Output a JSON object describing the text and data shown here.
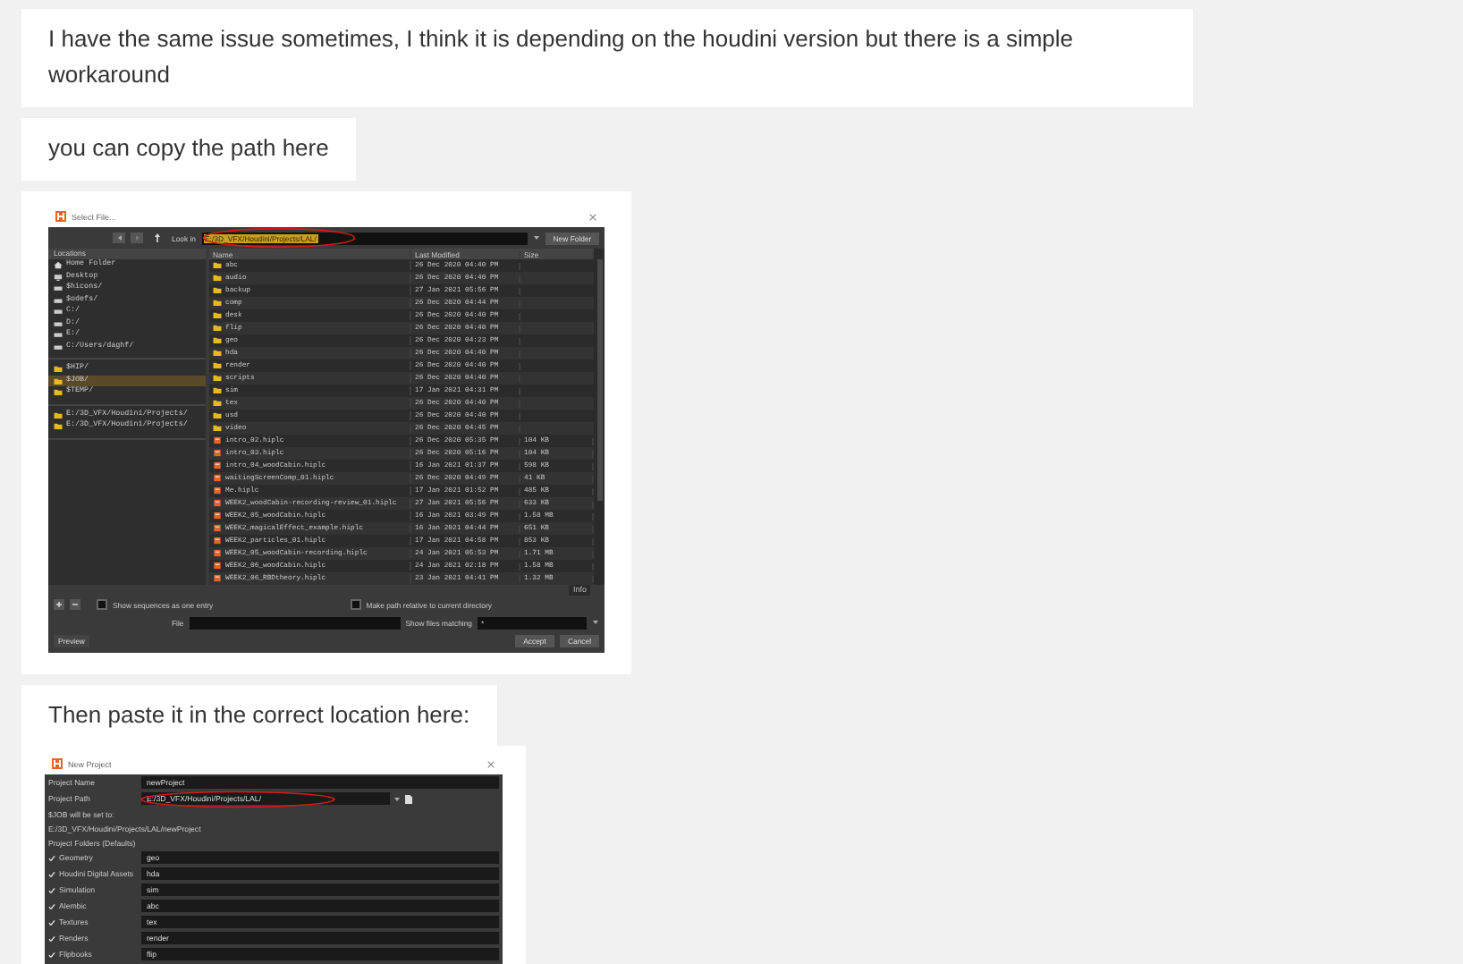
{
  "messages": [
    {
      "kind": "text",
      "text": "I have the same issue sometimes, I think it is depending on the houdini version but there is a simple workaround"
    },
    {
      "kind": "text",
      "text": "you can copy the path here"
    },
    {
      "kind": "file_dialog",
      "title": "Select File...",
      "look_in_label": "Look in",
      "path": "E:/3D_VFX/Houdini/Projects/LAL/",
      "new_folder": "New Folder",
      "locations_header": "Locations",
      "location_groups": [
        {
          "items": [
            {
              "label": "Home Folder",
              "selected": false
            },
            {
              "label": "Desktop",
              "selected": false
            },
            {
              "label": "$hicons/",
              "selected": false
            },
            {
              "label": "$odefs/",
              "selected": false
            },
            {
              "label": "C:/",
              "selected": false
            },
            {
              "label": "D:/",
              "selected": false
            },
            {
              "label": "E:/",
              "selected": false
            },
            {
              "label": "C:/Users/daghf/",
              "selected": false
            }
          ]
        },
        {
          "items": [
            {
              "label": "$HIP/",
              "selected": false
            },
            {
              "label": "$JOB/",
              "selected": true
            },
            {
              "label": "$TEMP/",
              "selected": false
            }
          ]
        },
        {
          "items": [
            {
              "label": "E:/3D_VFX/Houdini/Projects/",
              "selected": false
            },
            {
              "label": "E:/3D_VFX/Houdini/Projects/",
              "selected": false
            }
          ]
        }
      ],
      "columns": [
        "Name",
        "Last Modified",
        "Size"
      ],
      "files": [
        {
          "kind": "folder",
          "name": "abc",
          "modified": "26 Dec 2020 04:40 PM"
        },
        {
          "kind": "folder",
          "name": "audio",
          "modified": "26 Dec 2020 04:40 PM"
        },
        {
          "kind": "folder",
          "name": "backup",
          "modified": "27 Jan 2021 05:56 PM"
        },
        {
          "kind": "folder",
          "name": "comp",
          "modified": "26 Dec 2020 04:44 PM"
        },
        {
          "kind": "folder",
          "name": "desk",
          "modified": "26 Dec 2020 04:40 PM"
        },
        {
          "kind": "folder",
          "name": "flip",
          "modified": "26 Dec 2020 04:40 PM"
        },
        {
          "kind": "folder",
          "name": "geo",
          "modified": "26 Dec 2020 04:23 PM"
        },
        {
          "kind": "folder",
          "name": "hda",
          "modified": "26 Dec 2020 04:40 PM"
        },
        {
          "kind": "folder",
          "name": "render",
          "modified": "26 Dec 2020 04:40 PM"
        },
        {
          "kind": "folder",
          "name": "scripts",
          "modified": "26 Dec 2020 04:40 PM"
        },
        {
          "kind": "folder",
          "name": "sim",
          "modified": "17 Jan 2021 04:31 PM"
        },
        {
          "kind": "folder",
          "name": "tex",
          "modified": "26 Dec 2020 04:40 PM"
        },
        {
          "kind": "folder",
          "name": "usd",
          "modified": "26 Dec 2020 04:40 PM"
        },
        {
          "kind": "folder",
          "name": "video",
          "modified": "26 Dec 2020 04:45 PM"
        },
        {
          "kind": "file",
          "name": "intro_02.hiplc",
          "modified": "26 Dec 2020 05:35 PM",
          "size": "104 KB"
        },
        {
          "kind": "file",
          "name": "intro_03.hiplc",
          "modified": "26 Dec 2020 05:16 PM",
          "size": "104 KB"
        },
        {
          "kind": "file",
          "name": "intro_04_woodCabin.hiplc",
          "modified": "16 Jan 2021 01:37 PM",
          "size": "598 KB"
        },
        {
          "kind": "file",
          "name": "waitingScreenComp_01.hiplc",
          "modified": "26 Dec 2020 04:49 PM",
          "size": "41 KB"
        },
        {
          "kind": "file",
          "name": "Me.hiplc",
          "modified": "17 Jan 2021 01:52 PM",
          "size": "485 KB"
        },
        {
          "kind": "file",
          "name": "WEEK2_woodCabin-recording-review_01.hiplc",
          "modified": "27 Jan 2021 05:56 PM",
          "size": "633 KB"
        },
        {
          "kind": "file",
          "name": "WEEK2_05_woodCabin.hiplc",
          "modified": "16 Jan 2021 03:49 PM",
          "size": "1.58 MB"
        },
        {
          "kind": "file",
          "name": "WEEK2_magicalEffect_example.hiplc",
          "modified": "16 Jan 2021 04:44 PM",
          "size": "651 KB"
        },
        {
          "kind": "file",
          "name": "WEEK2_particles_01.hiplc",
          "modified": "17 Jan 2021 04:58 PM",
          "size": "853 KB"
        },
        {
          "kind": "file",
          "name": "WEEK2_05_woodCabin-recording.hiplc",
          "modified": "24 Jan 2021 05:53 PM",
          "size": "1.71 MB"
        },
        {
          "kind": "file",
          "name": "WEEK2_06_woodCabin.hiplc",
          "modified": "24 Jan 2021 02:18 PM",
          "size": "1.58 MB"
        },
        {
          "kind": "file",
          "name": "WEEK2_06_RBDtheory.hiplc",
          "modified": "23 Jan 2021 04:41 PM",
          "size": "1.32 MB"
        }
      ],
      "info": "Info",
      "show_sequences": {
        "label": "Show sequences as one entry",
        "checked": false
      },
      "relative_path": {
        "label": "Make path relative to current directory",
        "checked": false
      },
      "file_label": "File",
      "matching_label": "Show files matching",
      "matching_value": "*",
      "buttons": {
        "preview": "Preview",
        "accept": "Accept",
        "cancel": "Cancel"
      }
    },
    {
      "kind": "text",
      "text": "Then paste it in the correct location here:"
    },
    {
      "kind": "project_dialog",
      "title": "New Project",
      "name_label": "Project Name",
      "name_value": "newProject",
      "path_label": "Project Path",
      "path_value": "E:/3D_VFX/Houdini/Projects/LAL/",
      "job_note": "$JOB will be set to:",
      "job_path": "E:/3D_VFX/Houdini/Projects/LAL/newProject",
      "folders_header": "Project Folders (Defaults)",
      "folders": [
        {
          "label": "Geometry",
          "value": "geo",
          "checked": true
        },
        {
          "label": "Houdini Digital Assets",
          "value": "hda",
          "checked": true
        },
        {
          "label": "Simulation",
          "value": "sim",
          "checked": true
        },
        {
          "label": "Alembic",
          "value": "abc",
          "checked": true
        },
        {
          "label": "Textures",
          "value": "tex",
          "checked": true
        },
        {
          "label": "Renders",
          "value": "render",
          "checked": true
        },
        {
          "label": "Flipbooks",
          "value": "flip",
          "checked": true
        }
      ]
    }
  ]
}
